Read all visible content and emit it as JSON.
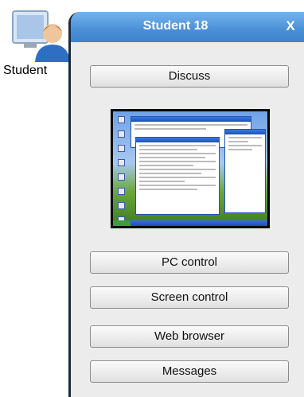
{
  "student_tile": {
    "label": "Student",
    "icon": "student-computer-icon"
  },
  "panel": {
    "title": "Student 18",
    "close_label": "X",
    "colors": {
      "header": "#4a8fd6",
      "background": "#ececec"
    }
  },
  "buttons": {
    "discuss": "Discuss",
    "pc_control": "PC control",
    "screen_control": "Screen control",
    "web_browser": "Web browser",
    "messages": "Messages"
  },
  "thumbnail": {
    "icon": "screen-thumbnail"
  }
}
